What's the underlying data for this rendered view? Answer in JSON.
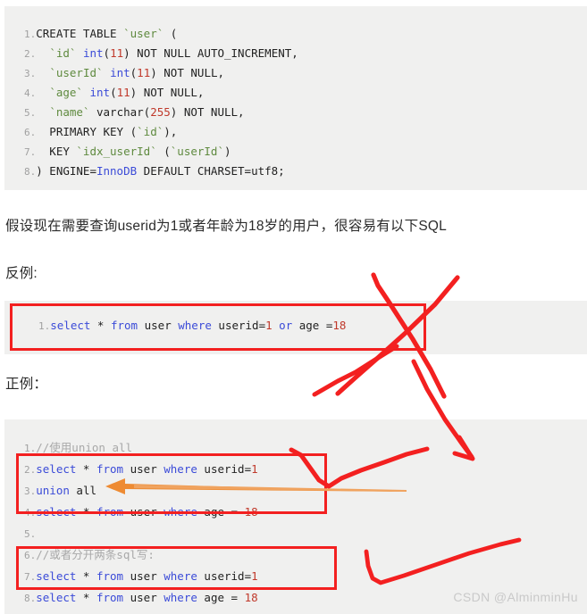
{
  "document": {
    "watermark": "CSDN @AlminminHu"
  },
  "prose": {
    "intro": "假设现在需要查询userid为1或者年龄为18岁的用户，很容易有以下SQL",
    "bad_label": "反例:",
    "good_label": "正例："
  },
  "code_create": {
    "title": "CREATE TABLE user",
    "lines": [
      {
        "n": "1.",
        "tokens": [
          {
            "t": "CREATE TABLE ",
            "c": "pl"
          },
          {
            "t": "`user`",
            "c": "str"
          },
          {
            "t": " (",
            "c": "pl"
          }
        ]
      },
      {
        "n": "2.",
        "tokens": [
          {
            "t": "  ",
            "c": "pl"
          },
          {
            "t": "`id`",
            "c": "str"
          },
          {
            "t": " ",
            "c": "pl"
          },
          {
            "t": "int",
            "c": "kw"
          },
          {
            "t": "(",
            "c": "pl"
          },
          {
            "t": "11",
            "c": "num"
          },
          {
            "t": ") NOT NULL AUTO_INCREMENT,",
            "c": "pl"
          }
        ]
      },
      {
        "n": "3.",
        "tokens": [
          {
            "t": "  ",
            "c": "pl"
          },
          {
            "t": "`userId`",
            "c": "str"
          },
          {
            "t": " ",
            "c": "pl"
          },
          {
            "t": "int",
            "c": "kw"
          },
          {
            "t": "(",
            "c": "pl"
          },
          {
            "t": "11",
            "c": "num"
          },
          {
            "t": ") NOT NULL,",
            "c": "pl"
          }
        ]
      },
      {
        "n": "4.",
        "tokens": [
          {
            "t": "  ",
            "c": "pl"
          },
          {
            "t": "`age`",
            "c": "str"
          },
          {
            "t": " ",
            "c": "pl"
          },
          {
            "t": "int",
            "c": "kw"
          },
          {
            "t": "(",
            "c": "pl"
          },
          {
            "t": "11",
            "c": "num"
          },
          {
            "t": ") NOT NULL,",
            "c": "pl"
          }
        ]
      },
      {
        "n": "5.",
        "tokens": [
          {
            "t": "  ",
            "c": "pl"
          },
          {
            "t": "`name`",
            "c": "str"
          },
          {
            "t": " varchar(",
            "c": "pl"
          },
          {
            "t": "255",
            "c": "num"
          },
          {
            "t": ") NOT NULL,",
            "c": "pl"
          }
        ]
      },
      {
        "n": "6.",
        "tokens": [
          {
            "t": "  PRIMARY KEY (",
            "c": "pl"
          },
          {
            "t": "`id`",
            "c": "str"
          },
          {
            "t": "),",
            "c": "pl"
          }
        ]
      },
      {
        "n": "7.",
        "tokens": [
          {
            "t": "  KEY ",
            "c": "pl"
          },
          {
            "t": "`idx_userId`",
            "c": "str"
          },
          {
            "t": " (",
            "c": "pl"
          },
          {
            "t": "`userId`",
            "c": "str"
          },
          {
            "t": ")",
            "c": "pl"
          }
        ]
      },
      {
        "n": "8.",
        "tokens": [
          {
            "t": ") ENGINE=",
            "c": "pl"
          },
          {
            "t": "InnoDB",
            "c": "kw"
          },
          {
            "t": " DEFAULT CHARSET=utf8;",
            "c": "pl"
          }
        ]
      }
    ]
  },
  "code_bad": {
    "lines": [
      {
        "n": "1.",
        "tokens": [
          {
            "t": "select",
            "c": "kw"
          },
          {
            "t": " * ",
            "c": "pl"
          },
          {
            "t": "from",
            "c": "kw"
          },
          {
            "t": " user ",
            "c": "pl"
          },
          {
            "t": "where",
            "c": "kw"
          },
          {
            "t": " userid=",
            "c": "pl"
          },
          {
            "t": "1",
            "c": "num"
          },
          {
            "t": " ",
            "c": "pl"
          },
          {
            "t": "or",
            "c": "kw"
          },
          {
            "t": " age =",
            "c": "pl"
          },
          {
            "t": "18",
            "c": "num"
          }
        ]
      }
    ]
  },
  "code_good": {
    "lines": [
      {
        "n": "1.",
        "tokens": [
          {
            "t": "//使用union all",
            "c": "cmt"
          }
        ]
      },
      {
        "n": "2.",
        "tokens": [
          {
            "t": "select",
            "c": "kw"
          },
          {
            "t": " * ",
            "c": "pl"
          },
          {
            "t": "from",
            "c": "kw"
          },
          {
            "t": " user ",
            "c": "pl"
          },
          {
            "t": "where",
            "c": "kw"
          },
          {
            "t": " userid=",
            "c": "pl"
          },
          {
            "t": "1",
            "c": "num"
          }
        ]
      },
      {
        "n": "3.",
        "tokens": [
          {
            "t": "union",
            "c": "kw"
          },
          {
            "t": " all",
            "c": "pl"
          }
        ]
      },
      {
        "n": "4.",
        "tokens": [
          {
            "t": "select",
            "c": "kw"
          },
          {
            "t": " * ",
            "c": "pl"
          },
          {
            "t": "from",
            "c": "kw"
          },
          {
            "t": " user ",
            "c": "pl"
          },
          {
            "t": "where",
            "c": "kw"
          },
          {
            "t": " age = ",
            "c": "pl"
          },
          {
            "t": "18",
            "c": "num"
          }
        ]
      },
      {
        "n": "5.",
        "tokens": [
          {
            "t": "",
            "c": "pl"
          }
        ]
      },
      {
        "n": "6.",
        "tokens": [
          {
            "t": "//或者分开两条sql写:",
            "c": "cmt"
          }
        ]
      },
      {
        "n": "7.",
        "tokens": [
          {
            "t": "select",
            "c": "kw"
          },
          {
            "t": " * ",
            "c": "pl"
          },
          {
            "t": "from",
            "c": "kw"
          },
          {
            "t": " user ",
            "c": "pl"
          },
          {
            "t": "where",
            "c": "kw"
          },
          {
            "t": " userid=",
            "c": "pl"
          },
          {
            "t": "1",
            "c": "num"
          }
        ]
      },
      {
        "n": "8.",
        "tokens": [
          {
            "t": "select",
            "c": "kw"
          },
          {
            "t": " * ",
            "c": "pl"
          },
          {
            "t": "from",
            "c": "kw"
          },
          {
            "t": " user ",
            "c": "pl"
          },
          {
            "t": "where",
            "c": "kw"
          },
          {
            "t": " age = ",
            "c": "pl"
          },
          {
            "t": "18",
            "c": "num"
          }
        ]
      }
    ]
  },
  "annotations": {
    "cross_out_bad_example": "red X drawn over the 反例 SQL",
    "check_mark_union": "red check mark over the union all block",
    "check_mark_split": "red check mark beside the split sql block",
    "arrow_to_union": "orange arrow pointing at the union all line",
    "arrow_down_right": "red arrow from upper area down to the right"
  },
  "colors": {
    "code_background": "#f0f0ef",
    "highlight_box": "#f32020",
    "annotation_red": "#f32020",
    "annotation_orange": "#ee8b33",
    "keyword": "#3b4bd8",
    "string": "#5f8a3f",
    "number": "#c0392b",
    "comment": "#a8a8a8",
    "line_number": "#a0a0a0",
    "watermark": "#c9c9c9"
  }
}
